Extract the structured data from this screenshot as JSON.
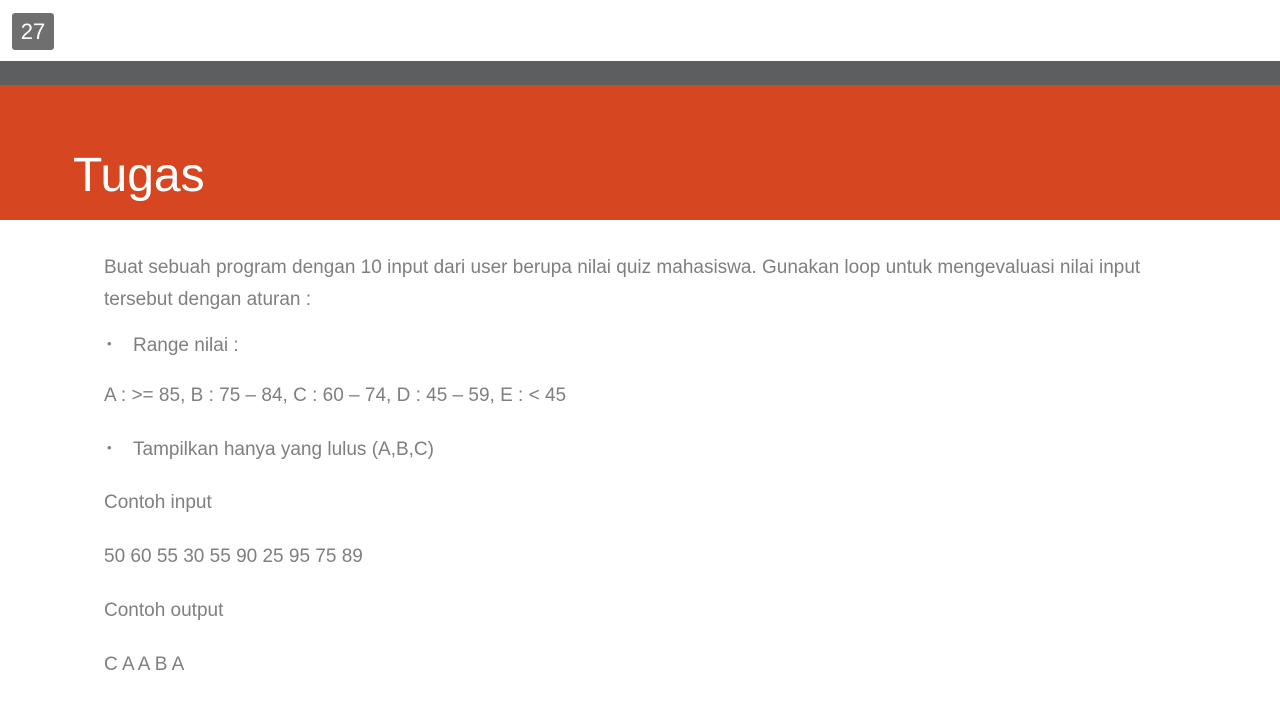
{
  "page_number": "27",
  "title": "Tugas",
  "intro": "Buat sebuah program dengan 10 input dari user berupa nilai quiz mahasiswa. Gunakan loop untuk mengevaluasi nilai input tersebut dengan aturan :",
  "bullet_glyph": "•",
  "bullets": [
    "Range nilai :",
    "Tampilkan hanya yang lulus (A,B,C)"
  ],
  "range_text": "A : >= 85, B : 75 – 84, C : 60 – 74, D : 45 – 59, E : < 45",
  "example_input_label": "Contoh input",
  "example_input_value": "50 60 55 30 55 90 25 95 75 89",
  "example_output_label": "Contoh output",
  "example_output_value": "C A A B A",
  "colors": {
    "accent_orange": "#d64620",
    "dark_band": "#5d5e60",
    "badge": "#6f6f6f",
    "body_text": "#7f7f7f"
  }
}
